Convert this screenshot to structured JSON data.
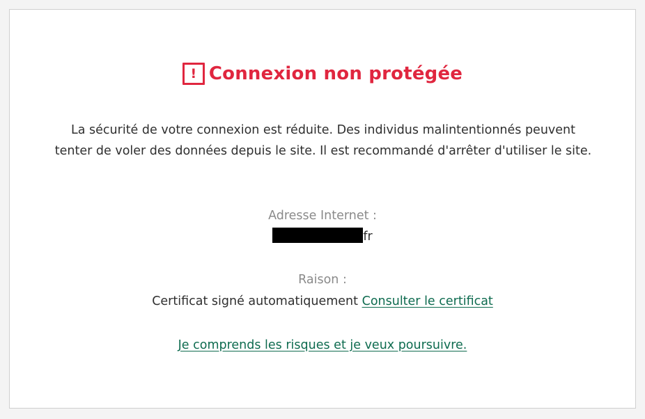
{
  "page": {
    "title": "Connexion non protégée",
    "warning_icon_glyph": "!",
    "description": "La sécurité de votre connexion est réduite. Des individus malintentionnés peuvent tenter de voler des données depuis le site. Il est recommandé d'arrêter d'utiliser le site.",
    "address_label": "Adresse Internet :",
    "address_suffix": "fr",
    "reason_label": "Raison :",
    "reason_text": "Certificat signé automatiquement",
    "view_certificate_link": "Consulter le certificat",
    "proceed_link": "Je comprends les risques et je veux poursuivre."
  },
  "colors": {
    "accent_red": "#e0263f",
    "link_green": "#0e6b4f",
    "text": "#2f2f2f",
    "muted": "#8a8a8a"
  },
  "icons": {
    "warning": "exclamation-square-icon"
  }
}
